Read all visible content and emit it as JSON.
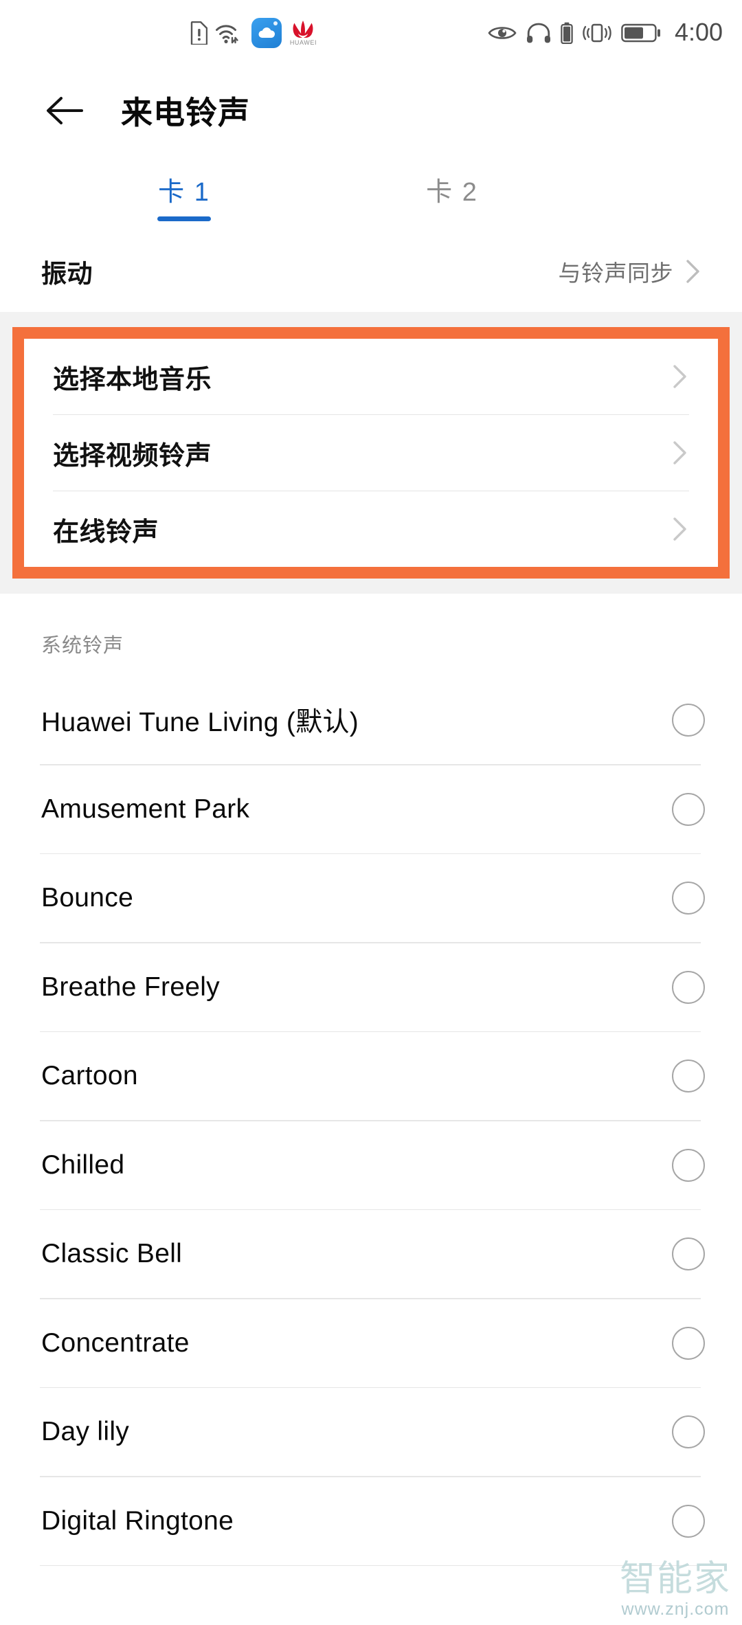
{
  "status_bar": {
    "left_icons": [
      "sim-card-alert-icon",
      "wifi-signal-icon",
      "cloud-app-icon",
      "huawei-logo-icon"
    ],
    "cloud_badge_label": "",
    "huawei_wordmark": "HUAWEI",
    "right_icons": [
      "eye-comfort-icon",
      "headset-icon",
      "headset-battery-icon",
      "vibrate-icon",
      "battery-icon"
    ],
    "time": "4:00"
  },
  "appbar": {
    "back_icon": "back-arrow-icon",
    "title": "来电铃声"
  },
  "tabs": [
    {
      "label": "卡 1",
      "active": true
    },
    {
      "label": "卡 2",
      "active": false
    }
  ],
  "vibration_row": {
    "label": "振动",
    "value": "与铃声同步",
    "chevron": "chevron-right-icon"
  },
  "highlighted_group": {
    "accent_color": "#f4703c",
    "items": [
      {
        "label": "选择本地音乐",
        "chevron": "chevron-right-icon"
      },
      {
        "label": "选择视频铃声",
        "chevron": "chevron-right-icon"
      },
      {
        "label": "在线铃声",
        "chevron": "chevron-right-icon"
      }
    ]
  },
  "system_section": {
    "header": "系统铃声",
    "ringtones": [
      {
        "name": "Huawei Tune Living (默认)",
        "selected": false
      },
      {
        "name": "Amusement Park",
        "selected": false
      },
      {
        "name": "Bounce",
        "selected": false
      },
      {
        "name": "Breathe Freely",
        "selected": false
      },
      {
        "name": "Cartoon",
        "selected": false
      },
      {
        "name": "Chilled",
        "selected": false
      },
      {
        "name": "Classic Bell",
        "selected": false
      },
      {
        "name": "Concentrate",
        "selected": false
      },
      {
        "name": "Day lily",
        "selected": false
      },
      {
        "name": "Digital Ringtone",
        "selected": false
      }
    ]
  },
  "watermark": {
    "name": "智能家",
    "url": "www.znj.com"
  },
  "colors": {
    "tab_active": "#1b6ac9",
    "accent_orange": "#f4703c",
    "background": "#ffffff",
    "band": "#f2f2f2"
  }
}
